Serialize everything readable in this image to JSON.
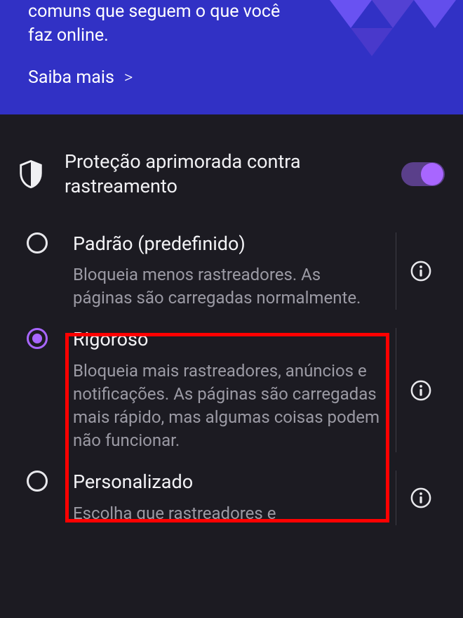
{
  "banner": {
    "text": "comuns que seguem o que você faz online.",
    "learn_more": "Saiba mais"
  },
  "section": {
    "title": "Proteção aprimorada contra rastreamento",
    "toggle_on": true
  },
  "options": [
    {
      "id": "standard",
      "title": "Padrão (predefinido)",
      "desc": "Bloqueia menos rastreadores. As páginas são carregadas normalmente.",
      "selected": false
    },
    {
      "id": "strict",
      "title": "Rigoroso",
      "desc": "Bloqueia mais rastreadores, anúncios e notificações. As páginas são carregadas mais rápido, mas algumas coisas podem não funcionar.",
      "selected": true
    },
    {
      "id": "custom",
      "title": "Personalizado",
      "desc": "Escolha que rastreadores e",
      "selected": false
    }
  ]
}
